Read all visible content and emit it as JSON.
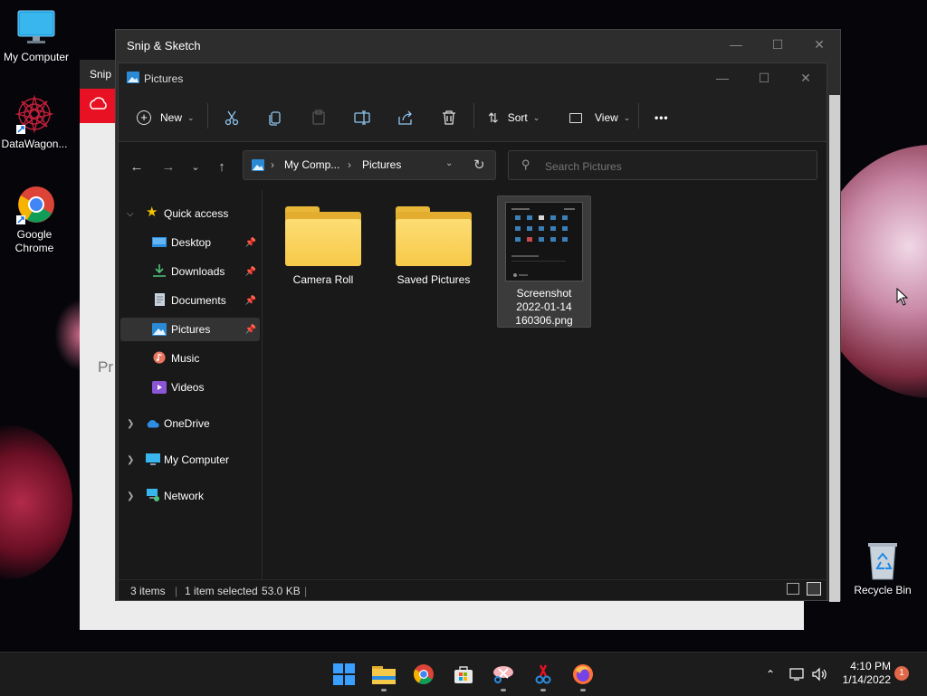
{
  "desktop": {
    "icons": [
      {
        "label": "My Computer",
        "icon": "monitor-icon"
      },
      {
        "label": "DataWagon...",
        "icon": "mandala-icon"
      },
      {
        "label": "Google Chrome",
        "icon": "chrome-icon"
      }
    ],
    "recycle_bin": {
      "label": "Recycle Bin",
      "icon": "recycle-bin-icon"
    }
  },
  "snip_back": {
    "title": "Snip",
    "partial_text": "Pr"
  },
  "snip_main": {
    "title": "Snip & Sketch"
  },
  "explorer": {
    "title": "Pictures",
    "toolbar": {
      "new_label": "New",
      "sort_label": "Sort",
      "view_label": "View",
      "more_label": "•••"
    },
    "address": {
      "root": "My Comp...",
      "current": "Pictures"
    },
    "search": {
      "placeholder": "Search Pictures"
    },
    "sidebar": {
      "quick_access": "Quick access",
      "items": [
        {
          "label": "Desktop",
          "pinned": true
        },
        {
          "label": "Downloads",
          "pinned": true
        },
        {
          "label": "Documents",
          "pinned": true
        },
        {
          "label": "Pictures",
          "pinned": true,
          "selected": true
        },
        {
          "label": "Music",
          "pinned": false
        },
        {
          "label": "Videos",
          "pinned": false
        }
      ],
      "onedrive": "OneDrive",
      "my_computer": "My Computer",
      "network": "Network"
    },
    "files": [
      {
        "name": "Camera Roll",
        "type": "folder"
      },
      {
        "name": "Saved Pictures",
        "type": "folder"
      },
      {
        "name": "Screenshot 2022-01-14 160306.png",
        "line1": "Screenshot",
        "line2": "2022-01-14",
        "line3": "160306.png",
        "type": "image",
        "selected": true
      }
    ],
    "status": {
      "items": "3 items",
      "selected": "1 item selected",
      "size": "53.0 KB"
    }
  },
  "taskbar": {
    "apps": [
      "start-icon",
      "file-explorer-icon",
      "chrome-icon",
      "store-icon",
      "snip-sketch-icon",
      "paint-icon",
      "firefox-icon"
    ],
    "time": "4:10 PM",
    "date": "1/14/2022",
    "notification_count": "1"
  },
  "colors": {
    "accent": "#0078d4",
    "folder": "#f7c948",
    "red": "#e81123"
  }
}
